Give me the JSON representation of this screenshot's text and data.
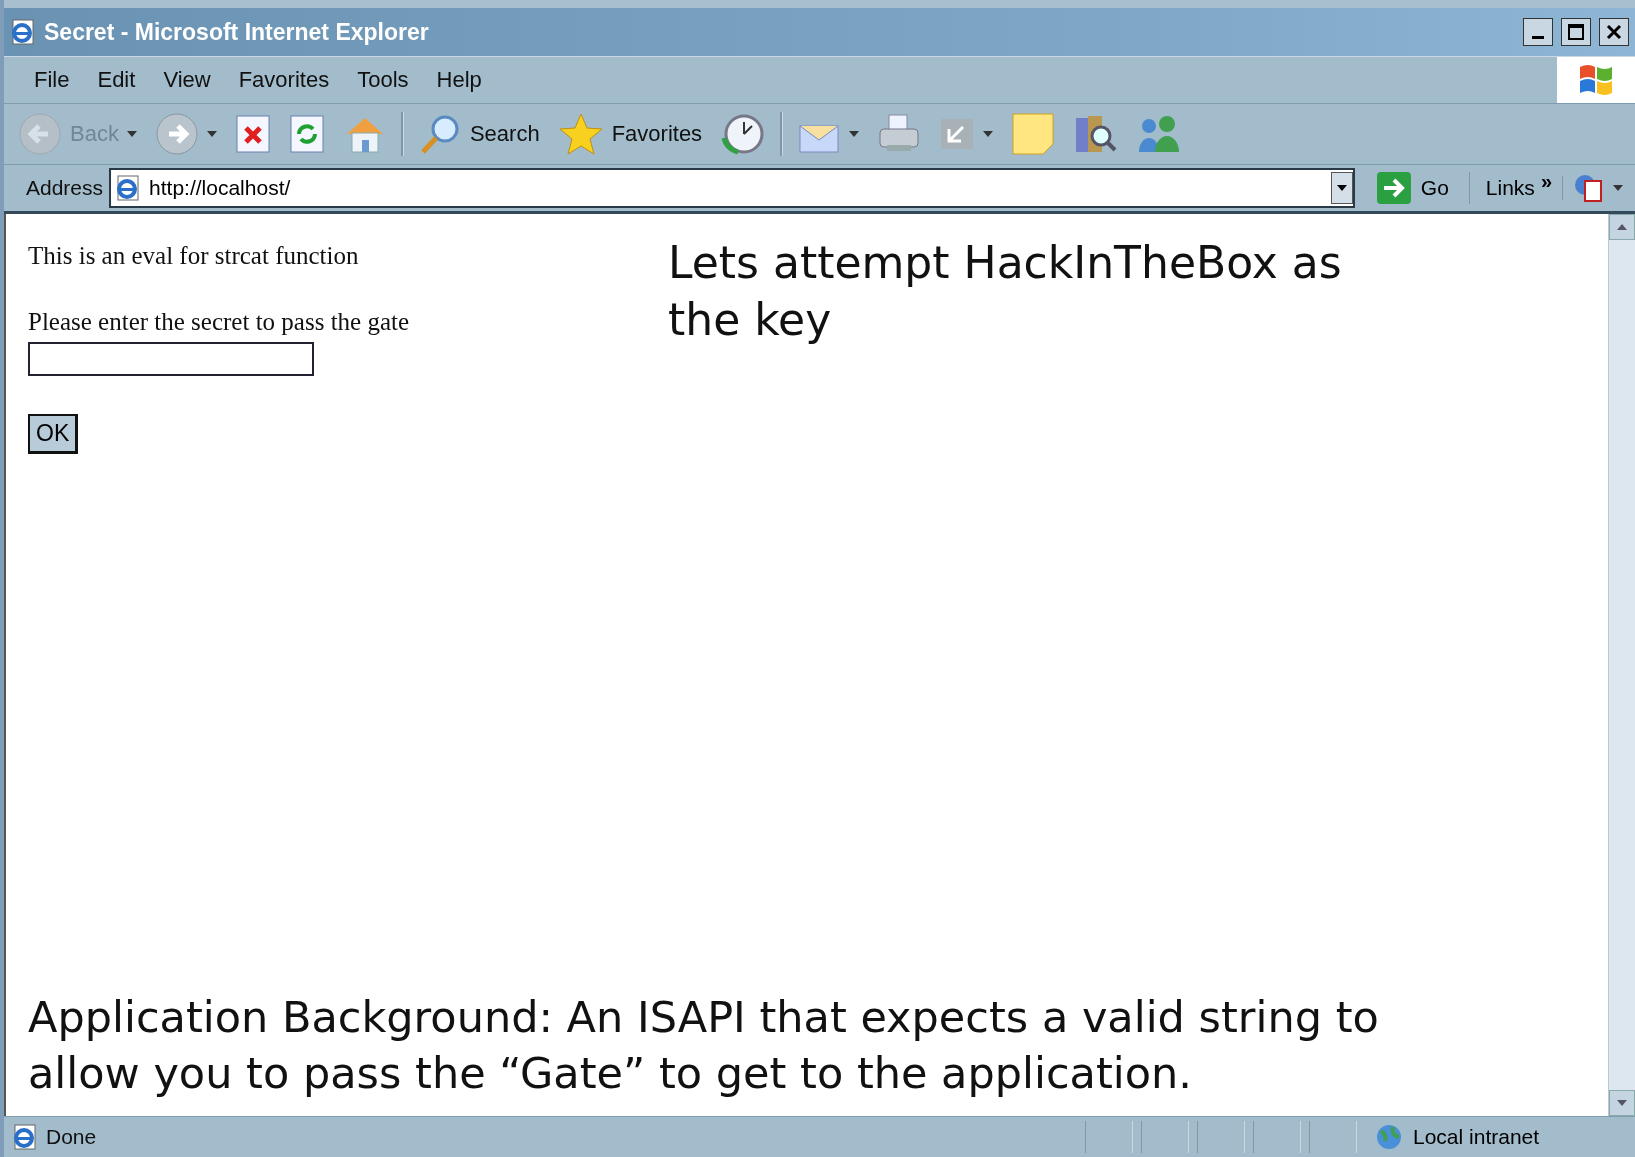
{
  "window": {
    "title": "Secret - Microsoft Internet Explorer"
  },
  "menu": [
    "File",
    "Edit",
    "View",
    "Favorites",
    "Tools",
    "Help"
  ],
  "toolbar": [
    {
      "label": "Back",
      "disabled": true,
      "dropdown": true
    },
    {
      "disabled": false,
      "dropdown": true
    },
    {
      "disabled": false,
      "dropdown": false
    },
    {
      "disabled": false,
      "dropdown": false
    },
    {
      "disabled": false,
      "dropdown": false
    },
    {
      "label": "Search",
      "disabled": false,
      "dropdown": false
    },
    {
      "label": "Favorites",
      "disabled": false,
      "dropdown": false
    },
    {
      "disabled": false,
      "dropdown": false
    },
    {
      "disabled": false,
      "dropdown": true
    },
    {
      "disabled": false,
      "dropdown": false
    },
    {
      "disabled": false,
      "dropdown": true
    },
    {
      "disabled": false,
      "dropdown": false
    },
    {
      "disabled": false,
      "dropdown": false
    },
    {
      "disabled": false,
      "dropdown": false
    }
  ],
  "address": {
    "label": "Address",
    "value": "http://localhost/",
    "go": "Go",
    "links": "Links",
    "chevron": "»"
  },
  "page": {
    "intro": "This is an eval for strcat function",
    "prompt": "Please enter the secret to pass the gate",
    "button": "OK"
  },
  "annotations": [
    "Lets attempt HackInTheBox as the key",
    "Application Background: An ISAPI that expects a valid string to allow you to pass the “Gate” to get to the application."
  ],
  "status_bar": {
    "text": "Done",
    "zone": "Local intranet"
  }
}
